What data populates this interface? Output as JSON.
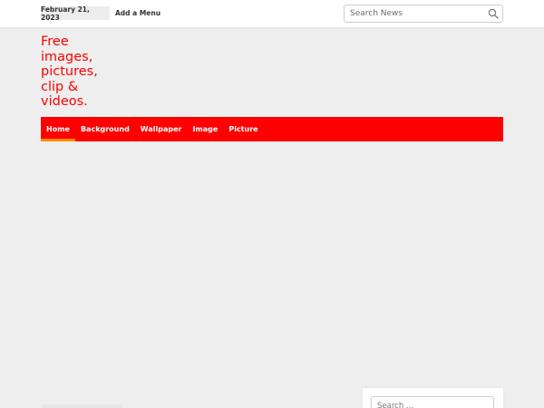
{
  "topbar": {
    "date": "February 21, 2023",
    "menu_link": "Add a Menu",
    "search_placeholder": "Search News"
  },
  "site": {
    "title": "Free images, pictures, clip & videos."
  },
  "nav": {
    "items": [
      {
        "label": "Home",
        "active": true
      },
      {
        "label": "Background",
        "active": false
      },
      {
        "label": "Wallpaper",
        "active": false
      },
      {
        "label": "Image",
        "active": false
      },
      {
        "label": "Picture",
        "active": false
      }
    ]
  },
  "sidebar": {
    "search_placeholder": "Search ..."
  },
  "colors": {
    "brand_red": "#ff0000",
    "active_underline": "#ff8a00",
    "background": "#eeeeee"
  }
}
